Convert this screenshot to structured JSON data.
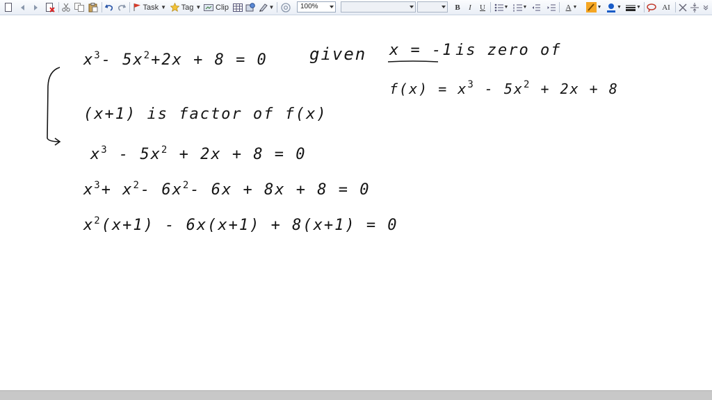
{
  "toolbar": {
    "task_label": "Task",
    "tag_label": "Tag",
    "clip_label": "Clip",
    "zoom_value": "100%",
    "bold_label": "B",
    "italic_label": "I",
    "underline_label": "U",
    "font_color_label": "A",
    "ai_label": "AI"
  },
  "note": {
    "line1": {
      "pre": "x",
      "e1": "3",
      "mid": "- 5x",
      "e2": "2",
      "post": "+2x + 8 = 0"
    },
    "given": "given",
    "given_value": "x = -1",
    "is_zero_of": "is zero of",
    "fx_def": {
      "pre": "f(x) = x",
      "e1": "3",
      "mid": " - 5x",
      "e2": "2",
      "post": " + 2x + 8"
    },
    "factor_line": "(x+1) is factor of f(x)",
    "line2": {
      "pre": "x",
      "e1": "3",
      "mid": " - 5x",
      "e2": "2",
      "post": " + 2x  + 8 = 0"
    },
    "line3": {
      "pre": "x",
      "e1": "3",
      "a": "+ x",
      "e2": "2",
      "b": "- 6x",
      "e3": "2",
      "post": "- 6x + 8x + 8 = 0"
    },
    "line4": {
      "pre": "x",
      "e1": "2",
      "post": "(x+1) - 6x(x+1) + 8(x+1) = 0"
    }
  },
  "colors": {
    "toolbar_bg": "#eef2f8",
    "ink": "#151515",
    "highlight_orange": "#f5a623",
    "font_color_blue": "#1a5cc7",
    "bottom_bar": "#c8c8c8"
  }
}
